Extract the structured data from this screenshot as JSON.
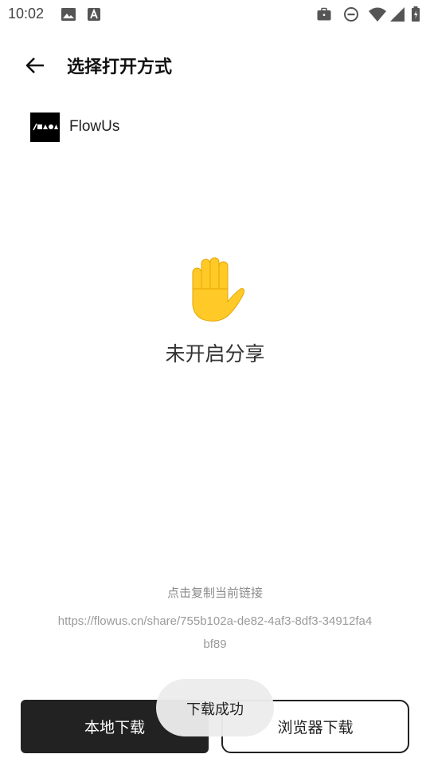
{
  "status_bar": {
    "time": "10:02",
    "left_icons": [
      "image-icon",
      "font-download-icon"
    ],
    "right_icons": [
      "briefcase-icon",
      "do-not-disturb-icon",
      "wifi-icon",
      "signal-icon",
      "battery-icon"
    ]
  },
  "app_bar": {
    "back_icon": "arrow-left-icon",
    "title": "选择打开方式"
  },
  "apps": [
    {
      "name": "FlowUs",
      "icon": "flowus-logo"
    }
  ],
  "empty_state": {
    "icon": "raised-hand-emoji",
    "message": "未开启分享"
  },
  "link_section": {
    "hint": "点击复制当前链接",
    "url": "https://flowus.cn/share/755b102a-de82-4af3-8df3-34912fa4bf89"
  },
  "buttons": {
    "local_download": "本地下载",
    "browser_download": "浏览器下载"
  },
  "toast": {
    "message": "下载成功"
  },
  "colors": {
    "primary_button_bg": "#222222",
    "hand_yellow": "#FFCA28",
    "muted_text": "#8a8a8a"
  }
}
